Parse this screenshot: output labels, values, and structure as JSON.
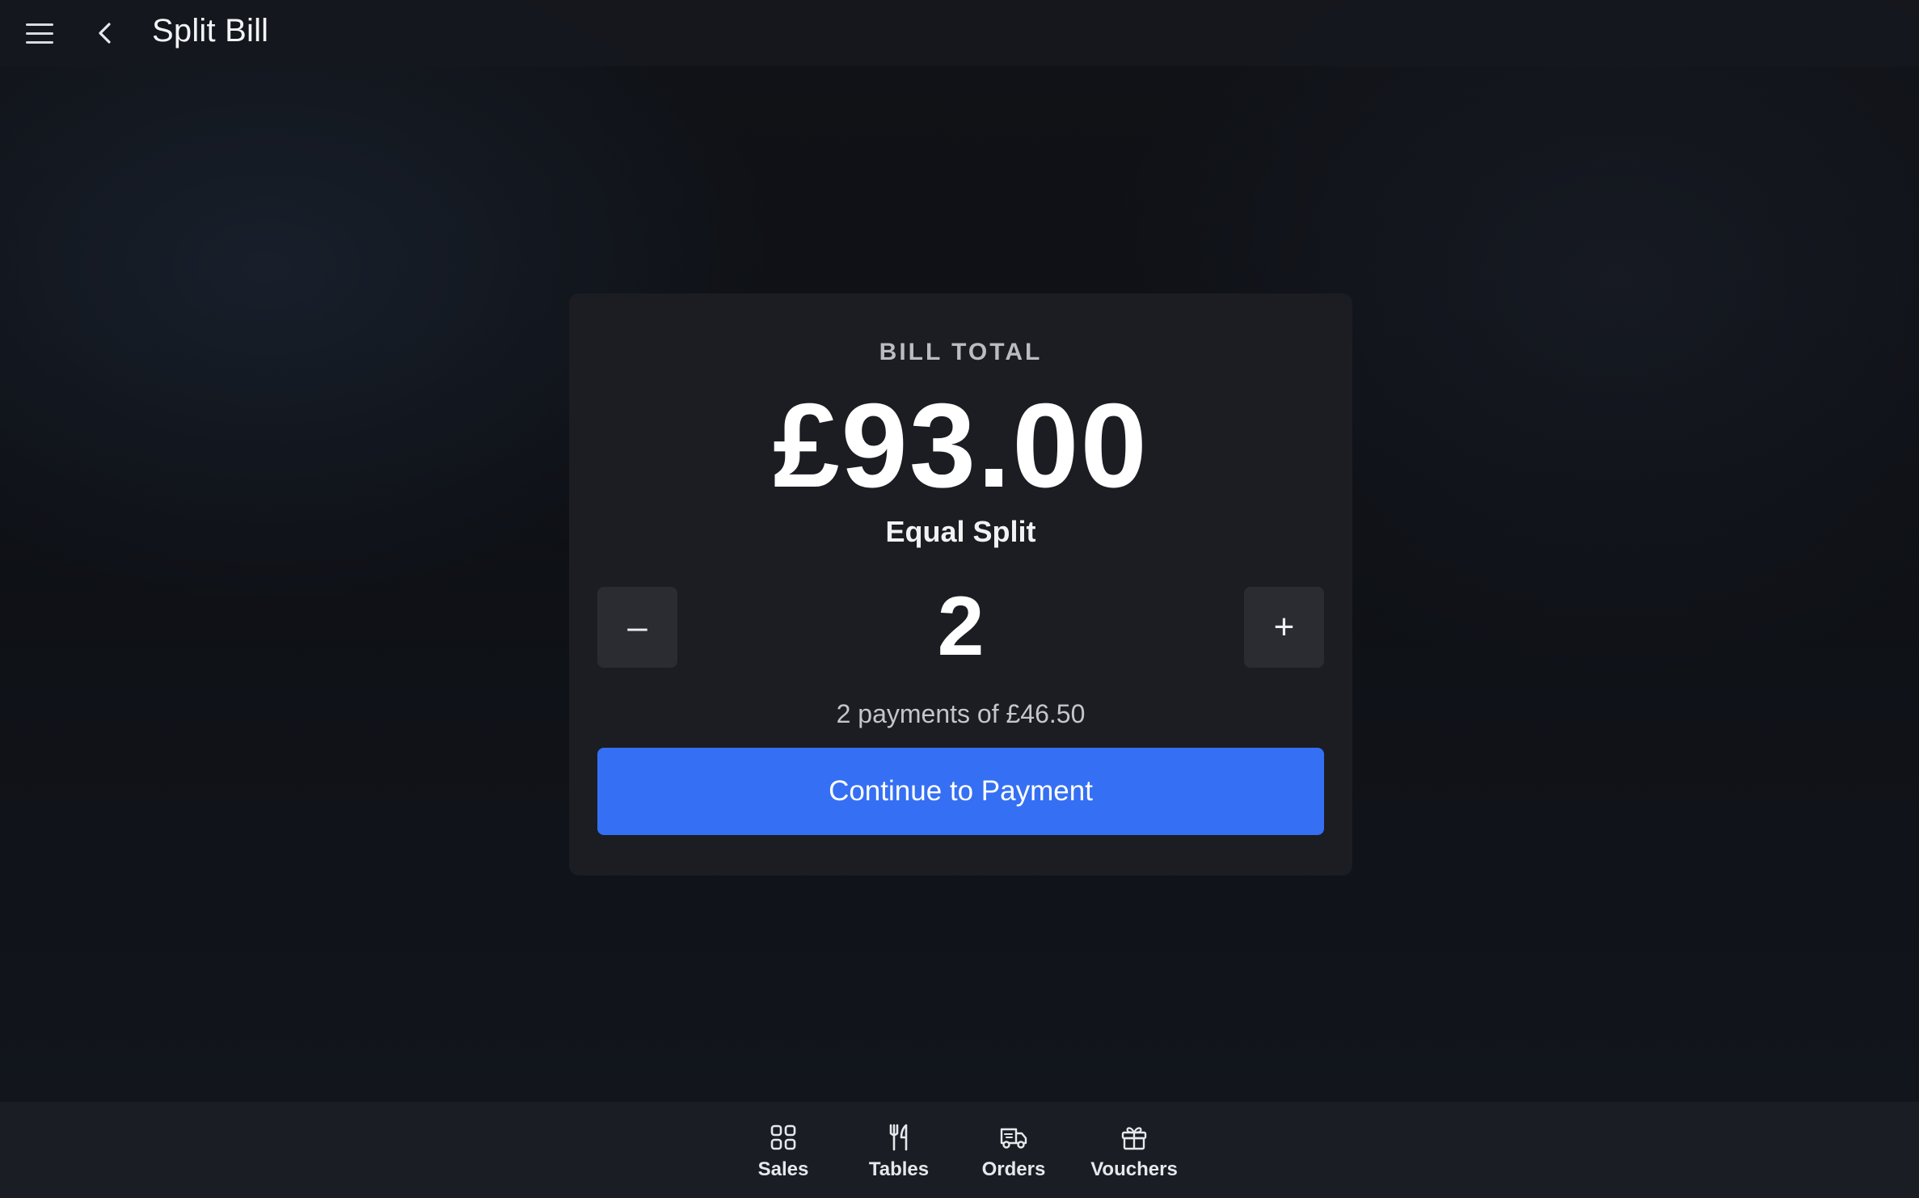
{
  "header": {
    "title": "Split Bill",
    "menu_icon": "hamburger-menu-icon",
    "back_icon": "chevron-left-icon"
  },
  "card": {
    "label": "BILL TOTAL",
    "total": "£93.00",
    "mode": "Equal Split",
    "decrement_label": "–",
    "increment_label": "+",
    "split_count": "2",
    "summary": "2 payments of £46.50",
    "continue_label": "Continue to Payment"
  },
  "bottom_nav": {
    "items": [
      {
        "label": "Sales",
        "icon": "grid-icon"
      },
      {
        "label": "Tables",
        "icon": "cutlery-icon"
      },
      {
        "label": "Orders",
        "icon": "delivery-truck-icon"
      },
      {
        "label": "Vouchers",
        "icon": "gift-icon"
      }
    ]
  },
  "colors": {
    "accent": "#356ff3",
    "card_background": "#1b1d22",
    "page_background": "#0f1116"
  }
}
